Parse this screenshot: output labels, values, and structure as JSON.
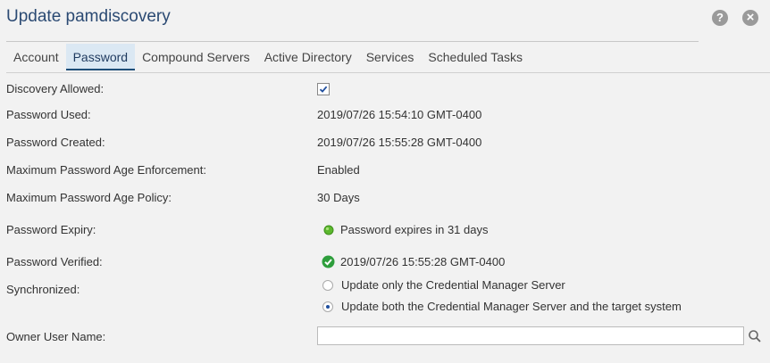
{
  "window": {
    "title": "Update pamdiscovery"
  },
  "header_icons": {
    "help": "?",
    "close": "×"
  },
  "tabs": [
    {
      "label": "Account",
      "active": false
    },
    {
      "label": "Password",
      "active": true
    },
    {
      "label": "Compound Servers",
      "active": false
    },
    {
      "label": "Active Directory",
      "active": false
    },
    {
      "label": "Services",
      "active": false
    },
    {
      "label": "Scheduled Tasks",
      "active": false
    }
  ],
  "fields": {
    "discovery_allowed": {
      "label": "Discovery Allowed:",
      "checked": true
    },
    "password_used": {
      "label": "Password Used:",
      "value": "2019/07/26 15:54:10 GMT-0400"
    },
    "password_created": {
      "label": "Password Created:",
      "value": "2019/07/26 15:55:28 GMT-0400"
    },
    "max_age_enforcement": {
      "label": "Maximum Password Age Enforcement:",
      "value": "Enabled"
    },
    "max_age_policy": {
      "label": "Maximum Password Age Policy:",
      "value": "30 Days"
    },
    "password_expiry": {
      "label": "Password Expiry:",
      "value": "Password expires in 31 days",
      "status_color": "#5cb82e"
    },
    "password_verified": {
      "label": "Password Verified:",
      "value": "2019/07/26 15:55:28 GMT-0400",
      "status_color": "#2e9e3c"
    },
    "synchronized": {
      "label": "Synchronized:",
      "options": [
        {
          "label": "Update only the Credential Manager Server",
          "selected": false
        },
        {
          "label": "Update both the Credential Manager Server and the target system",
          "selected": true
        }
      ]
    },
    "owner_user_name": {
      "label": "Owner User Name:",
      "value": "",
      "placeholder": ""
    }
  },
  "colors": {
    "accent": "#1f4e79",
    "tab_active_bg": "#dbe8f3",
    "title": "#2b4a73"
  }
}
